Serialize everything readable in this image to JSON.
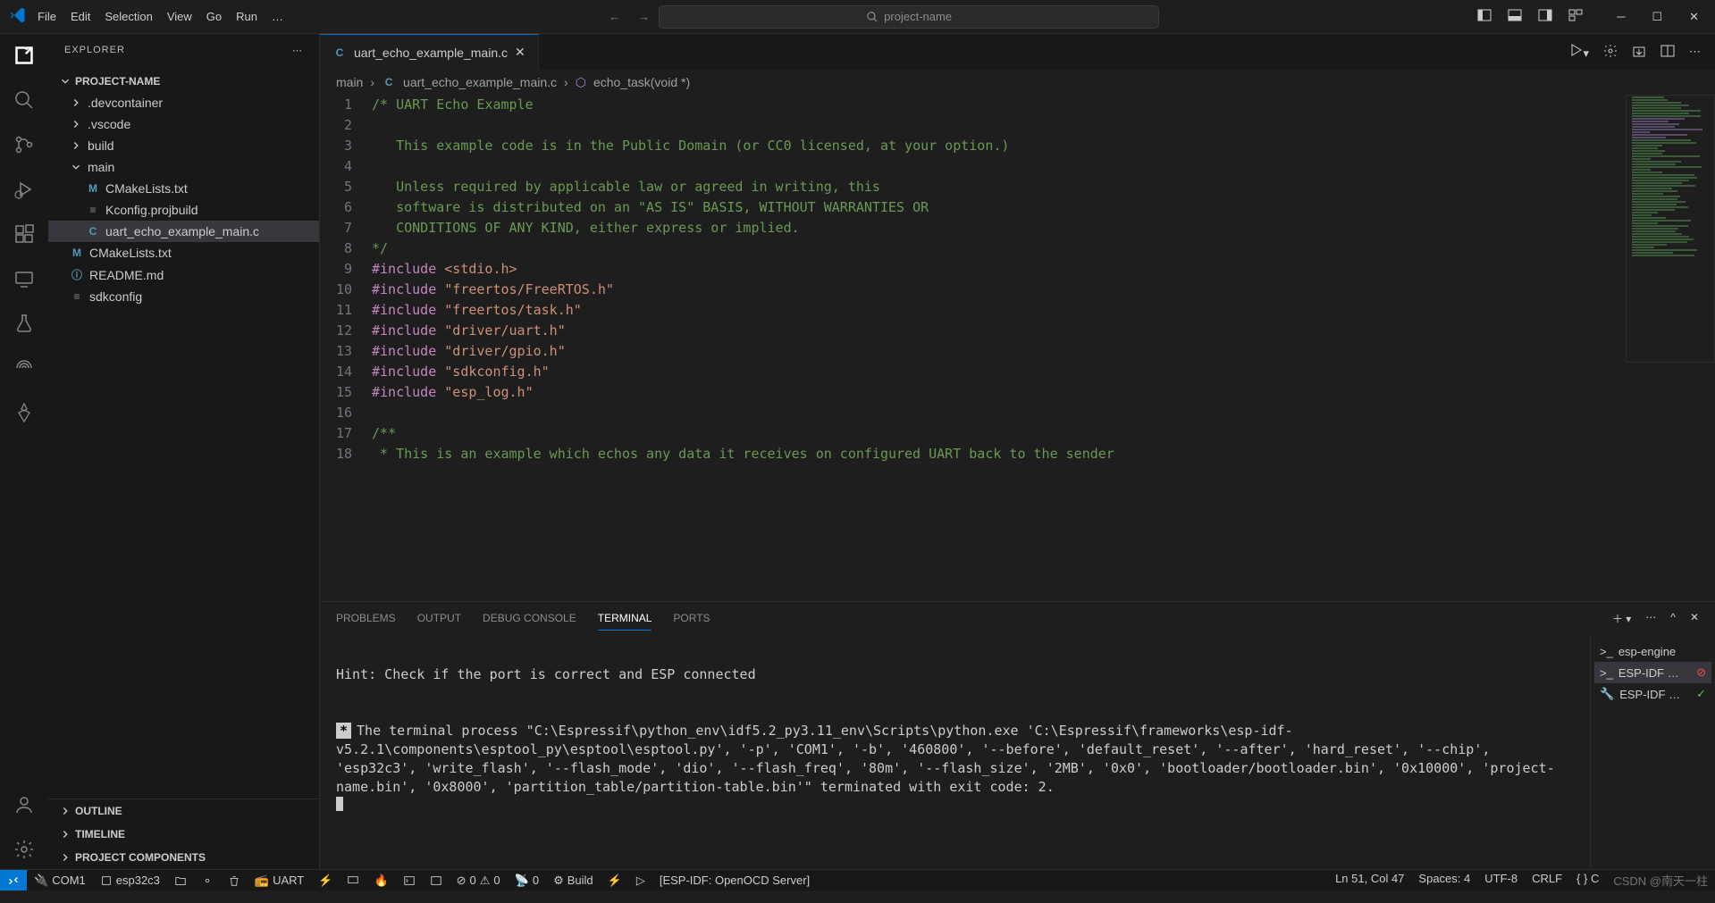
{
  "menu": [
    "File",
    "Edit",
    "Selection",
    "View",
    "Go",
    "Run",
    "…"
  ],
  "search_placeholder": "project-name",
  "explorer": {
    "title": "EXPLORER",
    "project": "PROJECT-NAME",
    "tree": [
      {
        "label": ".devcontainer",
        "type": "folder",
        "indent": 0
      },
      {
        "label": ".vscode",
        "type": "folder",
        "indent": 0
      },
      {
        "label": "build",
        "type": "folder",
        "indent": 0
      },
      {
        "label": "main",
        "type": "folder",
        "indent": 0,
        "expanded": true
      },
      {
        "label": "CMakeLists.txt",
        "type": "file",
        "icon": "M",
        "iconColor": "#519aba",
        "indent": 1
      },
      {
        "label": "Kconfig.projbuild",
        "type": "file",
        "icon": "≡",
        "iconColor": "#888",
        "indent": 1
      },
      {
        "label": "uart_echo_example_main.c",
        "type": "file",
        "icon": "C",
        "iconColor": "#519aba",
        "indent": 1,
        "active": true
      },
      {
        "label": "CMakeLists.txt",
        "type": "file",
        "icon": "M",
        "iconColor": "#519aba",
        "indent": 0
      },
      {
        "label": "README.md",
        "type": "file",
        "icon": "ⓘ",
        "iconColor": "#519aba",
        "indent": 0
      },
      {
        "label": "sdkconfig",
        "type": "file",
        "icon": "≡",
        "iconColor": "#888",
        "indent": 0
      }
    ],
    "sections": [
      "OUTLINE",
      "TIMELINE",
      "PROJECT COMPONENTS"
    ]
  },
  "tab": {
    "icon": "C",
    "label": "uart_echo_example_main.c"
  },
  "breadcrumb": {
    "root": "main",
    "file": "uart_echo_example_main.c",
    "symbol": "echo_task(void *)"
  },
  "code_lines": [
    {
      "n": 1,
      "html": "<span class='c-comment'>/* UART Echo Example</span>"
    },
    {
      "n": 2,
      "html": ""
    },
    {
      "n": 3,
      "html": "   <span class='c-comment'>This example code is in the Public Domain (or CC0 licensed, at your option.)</span>"
    },
    {
      "n": 4,
      "html": ""
    },
    {
      "n": 5,
      "html": "   <span class='c-comment'>Unless required by applicable law or agreed in writing, this</span>"
    },
    {
      "n": 6,
      "html": "   <span class='c-comment'>software is distributed on an \"AS IS\" BASIS, WITHOUT WARRANTIES OR</span>"
    },
    {
      "n": 7,
      "html": "   <span class='c-comment'>CONDITIONS OF ANY KIND, either express or implied.</span>"
    },
    {
      "n": 8,
      "html": "<span class='c-comment'>*/</span>"
    },
    {
      "n": 9,
      "html": "<span class='c-keyword'>#include</span> <span class='c-string'>&lt;stdio.h&gt;</span>"
    },
    {
      "n": 10,
      "html": "<span class='c-keyword'>#include</span> <span class='c-string'>\"freertos/FreeRTOS.h\"</span>"
    },
    {
      "n": 11,
      "html": "<span class='c-keyword'>#include</span> <span class='c-string'>\"freertos/task.h\"</span>"
    },
    {
      "n": 12,
      "html": "<span class='c-keyword'>#include</span> <span class='c-string'>\"driver/uart.h\"</span>"
    },
    {
      "n": 13,
      "html": "<span class='c-keyword'>#include</span> <span class='c-string'>\"driver/gpio.h\"</span>"
    },
    {
      "n": 14,
      "html": "<span class='c-keyword'>#include</span> <span class='c-string'>\"sdkconfig.h\"</span>"
    },
    {
      "n": 15,
      "html": "<span class='c-keyword'>#include</span> <span class='c-string'>\"esp_log.h\"</span>"
    },
    {
      "n": 16,
      "html": ""
    },
    {
      "n": 17,
      "html": "<span class='c-comment'>/**</span>"
    },
    {
      "n": 18,
      "html": "<span class='c-comment'> * This is an example which echos any data it receives on configured UART back to the sender</span>"
    }
  ],
  "panel": {
    "tabs": [
      "PROBLEMS",
      "OUTPUT",
      "DEBUG CONSOLE",
      "TERMINAL",
      "PORTS"
    ],
    "active": "TERMINAL",
    "hint": "Hint: Check if the port is correct and ESP connected",
    "body": "The terminal process \"C:\\Espressif\\python_env\\idf5.2_py3.11_env\\Scripts\\python.exe 'C:\\Espressif\\frameworks\\esp-idf-v5.2.1\\components\\esptool_py\\esptool\\esptool.py', '-p', 'COM1', '-b', '460800', '--before', 'default_reset', '--after', 'hard_reset', '--chip', 'esp32c3', 'write_flash', '--flash_mode', 'dio', '--flash_freq', '80m', '--flash_size', '2MB', '0x0', 'bootloader/bootloader.bin', '0x10000', 'project-name.bin', '0x8000', 'partition_table/partition-table.bin'\" terminated with exit code: 2.",
    "terminals": [
      {
        "label": "esp-engine",
        "icon": "shell"
      },
      {
        "label": "ESP-IDF …",
        "icon": "shell",
        "active": true,
        "kill": true
      },
      {
        "label": "ESP-IDF …",
        "icon": "wrench",
        "check": true
      }
    ]
  },
  "status": {
    "com": "COM1",
    "chip": "esp32c3",
    "uart": "UART",
    "errors": "0",
    "warnings": "0",
    "radio": "0",
    "build": "Build",
    "openocd": "[ESP-IDF: OpenOCD Server]",
    "cursor": "Ln 51, Col 47",
    "spaces": "Spaces: 4",
    "encoding": "UTF-8",
    "eol": "CRLF",
    "lang": "{ }  C",
    "watermark": "CSDN @南天一柱"
  }
}
